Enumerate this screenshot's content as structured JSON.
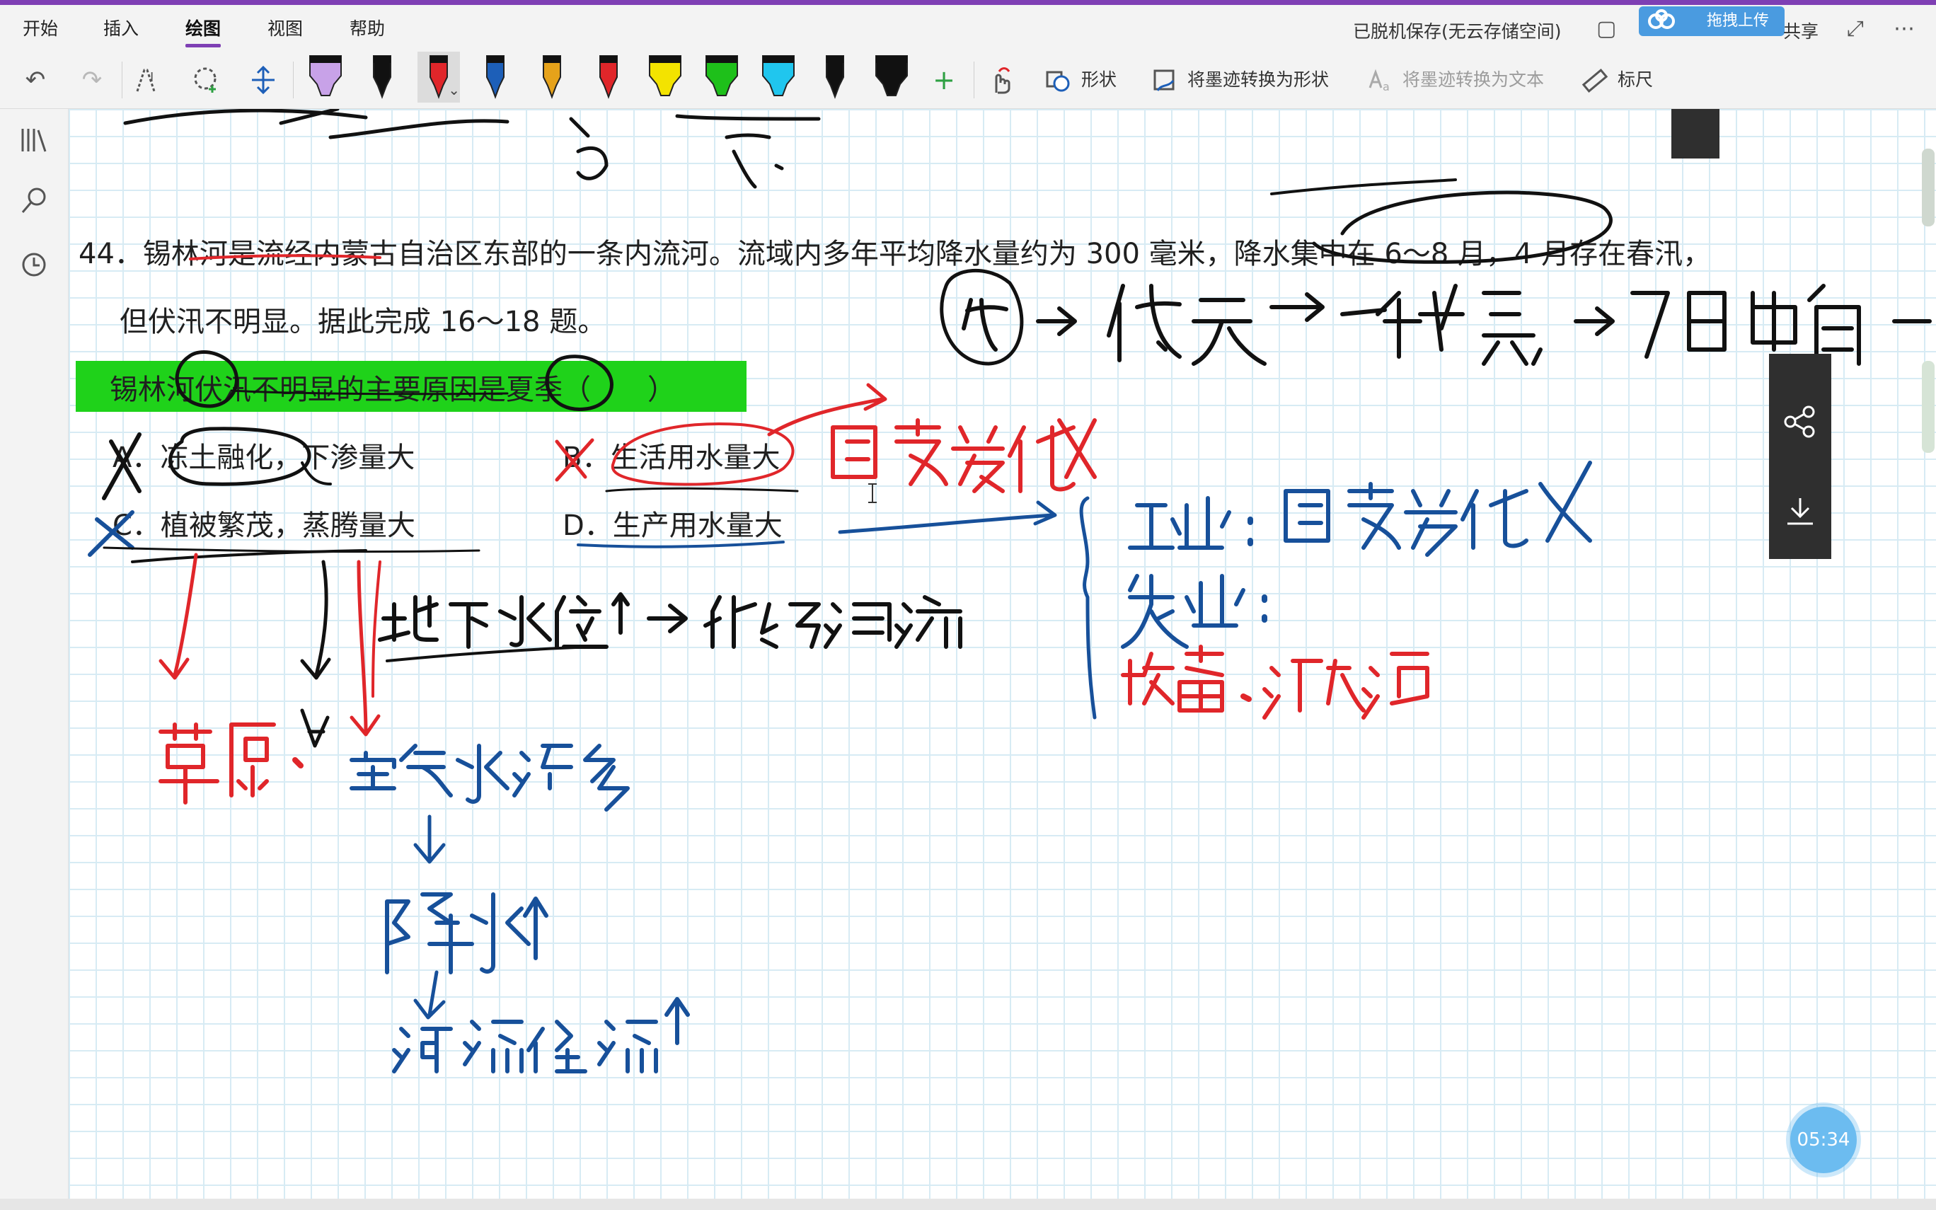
{
  "menu": {
    "tabs": [
      "开始",
      "插入",
      "绘图",
      "视图",
      "帮助"
    ],
    "active_tab": "绘图",
    "status": "已脱机保存(无云存储空间)",
    "upload_label": "拖拽上传",
    "share_label": "共享"
  },
  "toolbar": {
    "pens": [
      {
        "color": "#c8a2e8",
        "name": "purple-highlighter"
      },
      {
        "color": "#111111",
        "name": "black-pen"
      },
      {
        "color": "#e0262a",
        "name": "red-pen"
      },
      {
        "color": "#1d5fb8",
        "name": "blue-pen"
      },
      {
        "color": "#e6a21a",
        "name": "orange-pen"
      },
      {
        "color": "#e0262a",
        "name": "red-pen-2"
      },
      {
        "color": "#f3e300",
        "name": "yellow-highlighter"
      },
      {
        "color": "#1ec01a",
        "name": "green-highlighter"
      },
      {
        "color": "#20c6ee",
        "name": "cyan-highlighter"
      },
      {
        "color": "#111111",
        "name": "black-pen-2"
      },
      {
        "color": "#111111",
        "name": "black-highlighter"
      }
    ],
    "shape_label": "形状",
    "ink_to_shape_label": "将墨迹转换为形状",
    "ink_to_text_label": "将墨迹转换为文本",
    "ruler_label": "标尺"
  },
  "question": {
    "line1": "44．锡林河是流经内蒙古自治区东部的一条内流河。流域内多年平均降水量约为 300 毫米，降水集中在 6～8 月，4 月存在春汛，",
    "line2": "但伏汛不明显。据此完成 16～18 题。",
    "stem": "锡林河伏汛不明显的主要原因是夏季（　　）",
    "option_a": "A．冻土融化，下渗量大",
    "option_b": "B．生活用水量大",
    "option_c": "C．植被繁茂，蒸腾量大",
    "option_d": "D．生产用水量大"
  },
  "timer": "05:34",
  "colors": {
    "accent": "#7e3fb4",
    "ink_black": "#111111",
    "ink_red": "#e0262a",
    "ink_blue": "#17509a",
    "highlight_green": "#1fd21a",
    "grid": "#d7ebf4"
  }
}
